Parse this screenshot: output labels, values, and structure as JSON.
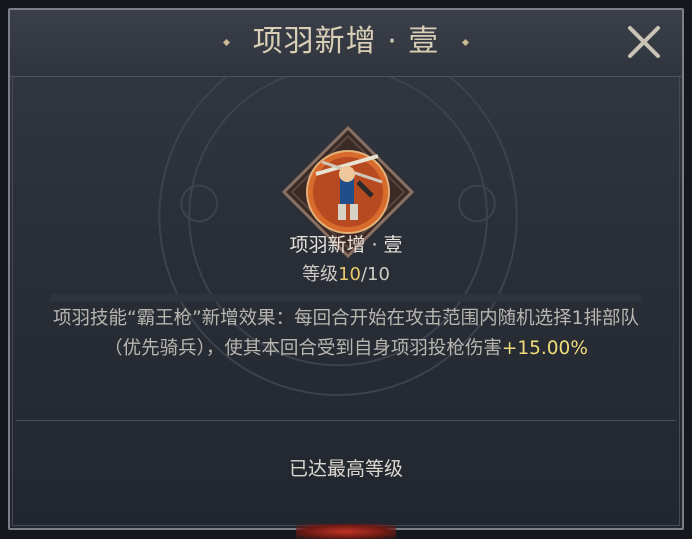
{
  "header": {
    "title": "项羽新增 · 壹",
    "close_icon": "close-icon"
  },
  "skill": {
    "icon": "xiangyu-spear-portrait-icon",
    "name": "项羽新增 · 壹",
    "level_prefix": "等级",
    "level_current": "10",
    "level_suffix": "/10",
    "description_main": "项羽技能“霸王枪”新增效果：每回合开始在攻击范围内随机选择1排部队（优先骑兵），使其本回合受到自身项羽投枪伤害",
    "description_bonus": "+15.00%"
  },
  "footer": {
    "status": "已达最高等级"
  },
  "colors": {
    "title": "#d9cfb6",
    "level_highlight": "#e8c86a",
    "bonus": "#f0dc7a",
    "frame": "#7d7f86"
  }
}
